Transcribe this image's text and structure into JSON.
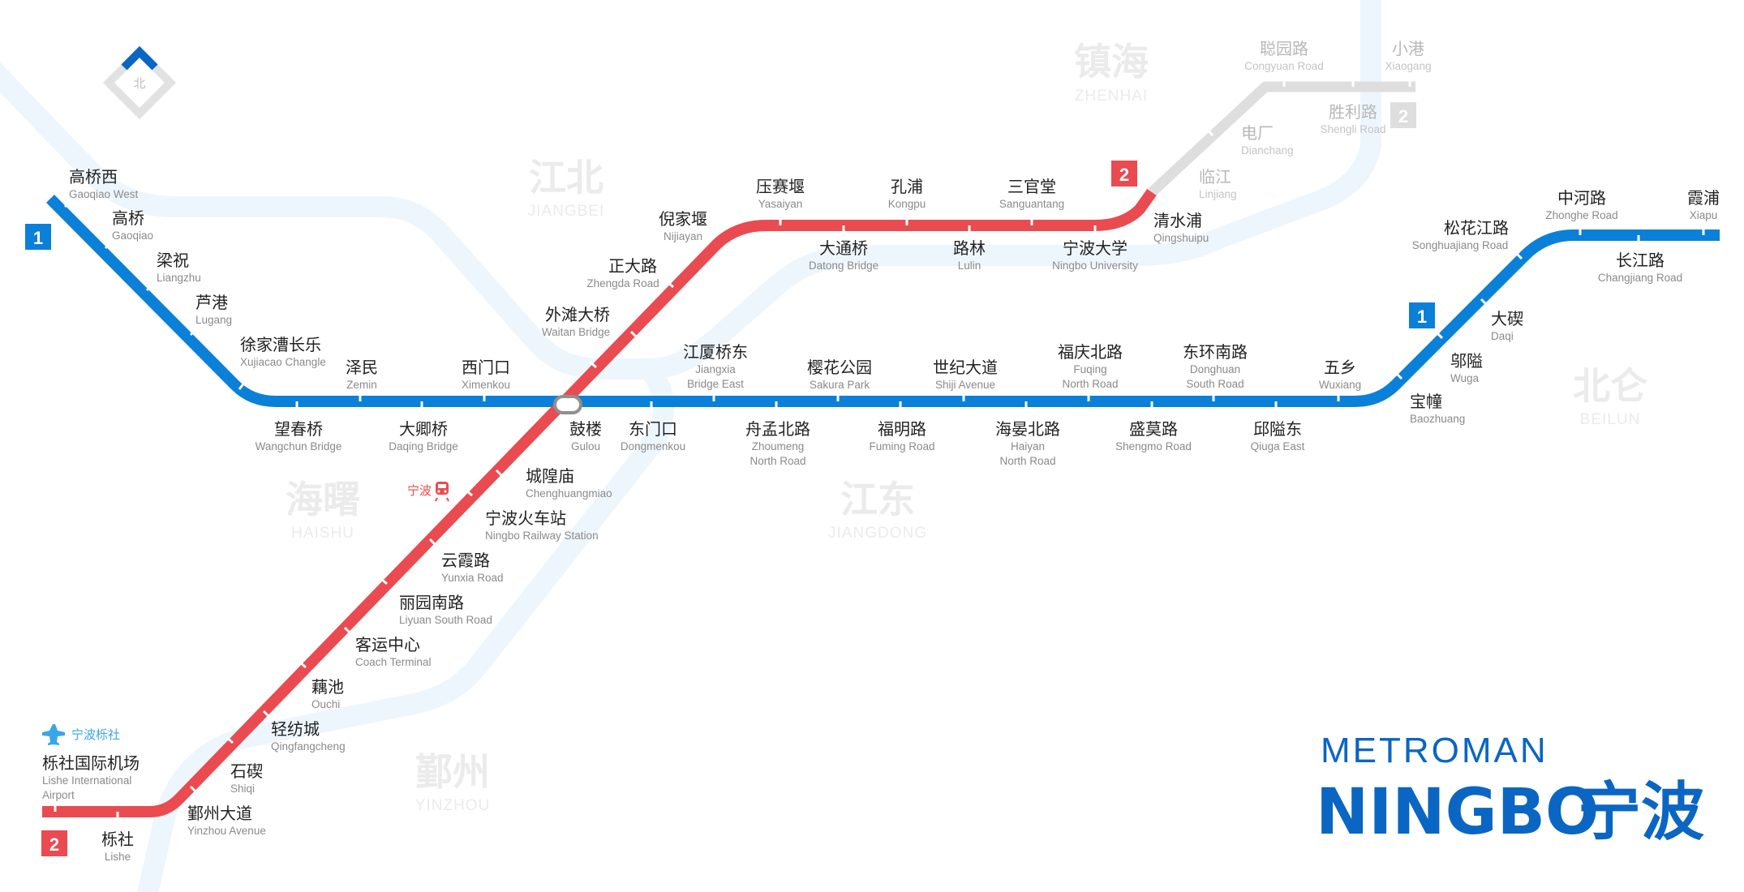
{
  "colors": {
    "line1": "#0a80d8",
    "line2": "#e94b50",
    "line2_future": "#dedede",
    "water": "#eef6fd",
    "district": "#ebebeb",
    "brand": "#0a66c2",
    "airport": "#3aa6ea"
  },
  "compass": {
    "label": "北",
    "icon": "north-compass-icon"
  },
  "districts": {
    "zhenhai": {
      "zh": "镇海",
      "en": "ZHENHAI"
    },
    "jiangbei": {
      "zh": "江北",
      "en": "JIANGBEI"
    },
    "haishu": {
      "zh": "海曙",
      "en": "HAISHU"
    },
    "jiangdong": {
      "zh": "江东",
      "en": "JIANGDONG"
    },
    "beilun": {
      "zh": "北仑",
      "en": "BEILUN"
    },
    "yinzhou": {
      "zh": "鄞州",
      "en": "YINZHOU"
    }
  },
  "lines": {
    "line1": {
      "badge": "1"
    },
    "line2": {
      "badge": "2"
    }
  },
  "stations": {
    "gaoqiaoxi": {
      "zh": "高桥西",
      "en": "Gaoqiao West"
    },
    "gaoqiao": {
      "zh": "高桥",
      "en": "Gaoqiao"
    },
    "liangzhu": {
      "zh": "梁祝",
      "en": "Liangzhu"
    },
    "lugang": {
      "zh": "芦港",
      "en": "Lugang"
    },
    "xujiacao": {
      "zh": "徐家漕长乐",
      "en": "Xujiacao Changle"
    },
    "wangchun": {
      "zh": "望春桥",
      "en": "Wangchun Bridge"
    },
    "zemin": {
      "zh": "泽民",
      "en": "Zemin"
    },
    "daqing": {
      "zh": "大卿桥",
      "en": "Daqing Bridge"
    },
    "ximenkou": {
      "zh": "西门口",
      "en": "Ximenkou"
    },
    "gulou": {
      "zh": "鼓楼",
      "en": "Gulou"
    },
    "dongmenkou": {
      "zh": "东门口",
      "en": "Dongmenkou"
    },
    "jiangxia": {
      "zh": "江厦桥东",
      "en1": "Jiangxia",
      "en2": "Bridge East"
    },
    "zhoumeng": {
      "zh": "舟孟北路",
      "en1": "Zhoumeng",
      "en2": "North Road"
    },
    "sakura": {
      "zh": "樱花公园",
      "en": "Sakura Park"
    },
    "fuming": {
      "zh": "福明路",
      "en": "Fuming Road"
    },
    "shiji": {
      "zh": "世纪大道",
      "en": "Shiji Avenue"
    },
    "haiyan": {
      "zh": "海晏北路",
      "en1": "Haiyan",
      "en2": "North Road"
    },
    "fuqing": {
      "zh": "福庆北路",
      "en1": "Fuqing",
      "en2": "North Road"
    },
    "shengmo": {
      "zh": "盛莫路",
      "en": "Shengmo Road"
    },
    "donghuan": {
      "zh": "东环南路",
      "en1": "Donghuan",
      "en2": "South Road"
    },
    "qiuga": {
      "zh": "邱隘东",
      "en": "Qiuga East"
    },
    "wuxiang": {
      "zh": "五乡",
      "en": "Wuxiang"
    },
    "baozhuang": {
      "zh": "宝幢",
      "en": "Baozhuang"
    },
    "wuga": {
      "zh": "邬隘",
      "en": "Wuga"
    },
    "daqi": {
      "zh": "大碶",
      "en": "Daqi"
    },
    "songhuajiang": {
      "zh": "松花江路",
      "en": "Songhuajiang Road"
    },
    "zhonghe": {
      "zh": "中河路",
      "en": "Zhonghe Road"
    },
    "changjiang": {
      "zh": "长江路",
      "en": "Changjiang Road"
    },
    "xiapu": {
      "zh": "霞浦",
      "en": "Xiapu"
    },
    "nijiayan": {
      "zh": "倪家堰",
      "en": "Nijiayan"
    },
    "zhengda": {
      "zh": "正大路",
      "en": "Zhengda Road"
    },
    "waitan": {
      "zh": "外滩大桥",
      "en": "Waitan Bridge"
    },
    "yasaiyan": {
      "zh": "压赛堰",
      "en": "Yasaiyan"
    },
    "datong": {
      "zh": "大通桥",
      "en": "Datong Bridge"
    },
    "kongpu": {
      "zh": "孔浦",
      "en": "Kongpu"
    },
    "lulin": {
      "zh": "路林",
      "en": "Lulin"
    },
    "sanguantang": {
      "zh": "三官堂",
      "en": "Sanguantang"
    },
    "ningbouni": {
      "zh": "宁波大学",
      "en": "Ningbo University"
    },
    "qingshuipu": {
      "zh": "清水浦",
      "en": "Qingshuipu"
    },
    "linjiang": {
      "zh": "临江",
      "en": "Linjiang"
    },
    "dianchang": {
      "zh": "电厂",
      "en": "Dianchang"
    },
    "congyuan": {
      "zh": "聪园路",
      "en": "Congyuan Road"
    },
    "shengli": {
      "zh": "胜利路",
      "en": "Shengli Road"
    },
    "xiaogang": {
      "zh": "小港",
      "en": "Xiaogang"
    },
    "chenghuangmiao": {
      "zh": "城隍庙",
      "en": "Chenghuangmiao"
    },
    "railway": {
      "zh": "宁波火车站",
      "en": "Ningbo Railway Station"
    },
    "yunxia": {
      "zh": "云霞路",
      "en": "Yunxia Road"
    },
    "liyuan": {
      "zh": "丽园南路",
      "en": "Liyuan South Road"
    },
    "coach": {
      "zh": "客运中心",
      "en": "Coach Terminal"
    },
    "ouchi": {
      "zh": "藕池",
      "en": "Ouchi"
    },
    "qingfang": {
      "zh": "轻纺城",
      "en": "Qingfangcheng"
    },
    "shiqi": {
      "zh": "石碶",
      "en": "Shiqi"
    },
    "yinzhouave": {
      "zh": "鄞州大道",
      "en": "Yinzhou Avenue"
    },
    "lishe_airport": {
      "zh": "栎社国际机场",
      "en1": "Lishe International",
      "en2": "Airport"
    },
    "lishe": {
      "zh": "栎社",
      "en": "Lishe"
    }
  },
  "poi": {
    "railway": {
      "label": "宁波",
      "icon": "train-icon"
    },
    "airport": {
      "label": "宁波栎社",
      "icon": "airplane-icon"
    }
  },
  "brand": {
    "small": "METROMAN",
    "big_latin": "NINGBO",
    "big_zh": "宁波"
  }
}
